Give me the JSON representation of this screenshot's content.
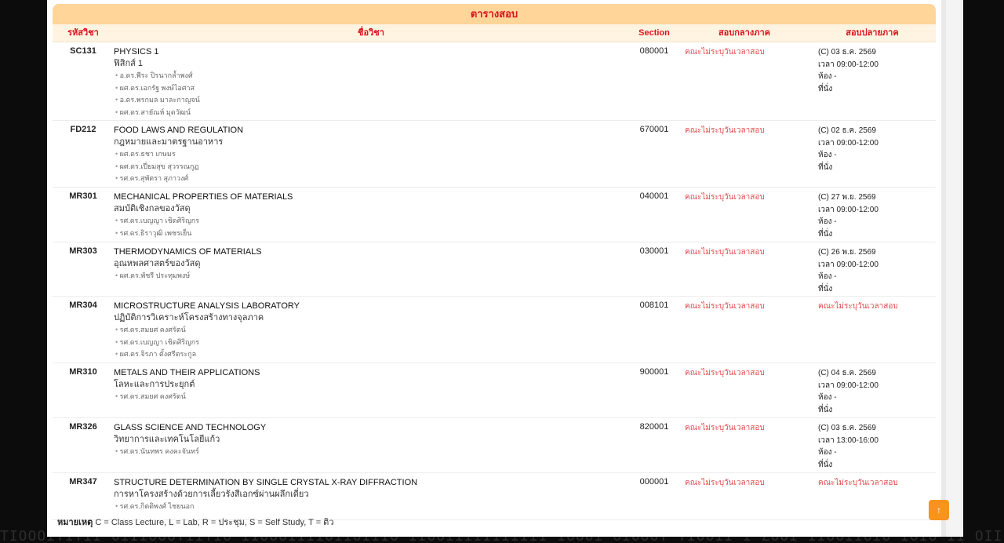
{
  "background_text": "ΤΙΟΟΟΙΤΙΥΊΙ ΟΙΙΙΟΟΟΤΙΙΤΙΟ ΊΙΟΟΟΙΙΊΙΟΙΙΟΊΙΙΟ ΙΙΟΟΙΙΙΙΙΙΙΙΙΙΙ ΙΟΟΟΙ ΟΙΟΟΟΥ ΥΙΟΟΙΙ Ι ΖΟΟΙ ΙΙΟΟΙΙΟΙΟ ΙΟΊΟ ΙΙ ΟΙΙ",
  "table": {
    "title": "ตารางสอบ",
    "headers": {
      "code": "รหัสวิชา",
      "name": "ชื่อวิชา",
      "section": "Section",
      "midterm": "สอบกลางภาค",
      "final": "สอบปลายภาค"
    },
    "rows": [
      {
        "code": "SC131",
        "name_en": "PHYSICS 1",
        "name_th": "ฟิสิกส์ 1",
        "instructors": [
          "อ.ดร.พีระ ปิรนากล้ำพงศ์",
          "ผศ.ดร.เอกรัฐ พงษ์ไอศาส",
          "อ.ดร.พรกมล มาละกาญจน์",
          "ผศ.ดร.สายัณห์ มุดวัฒน์"
        ],
        "section": "080001",
        "midterm": "คณะไม่ระบุวันเวลาสอบ",
        "final": [
          "(C) 03 ธ.ค. 2569",
          "เวลา 09:00-12:00",
          "ห้อง -",
          "ที่นั่ง"
        ]
      },
      {
        "code": "FD212",
        "name_en": "FOOD LAWS AND REGULATION",
        "name_th": "กฎหมายและมาตรฐานอาหาร",
        "instructors": [
          "ผศ.ดร.ธชา เกษมร",
          "ผศ.ดร.เปี่ยมสุข สุวรรณกูฏ",
          "รศ.ดร.สุพัตรา สุภาวงศ์"
        ],
        "section": "670001",
        "midterm": "คณะไม่ระบุวันเวลาสอบ",
        "final": [
          "(C) 02 ธ.ค. 2569",
          "เวลา 09:00-12:00",
          "ห้อง -",
          "ที่นั่ง"
        ]
      },
      {
        "code": "MR301",
        "name_en": "MECHANICAL PROPERTIES OF MATERIALS",
        "name_th": "สมบัติเชิงกลของวัสดุ",
        "instructors": [
          "รศ.ดร.เบญญา เชิดศิริญกร",
          "รศ.ดร.ธิราวุฒิ เพชรเย็น"
        ],
        "section": "040001",
        "midterm": "คณะไม่ระบุวันเวลาสอบ",
        "final": [
          "(C) 27 พ.ย. 2569",
          "เวลา 09:00-12:00",
          "ห้อง -",
          "ที่นั่ง"
        ]
      },
      {
        "code": "MR303",
        "name_en": "THERMODYNAMICS OF MATERIALS",
        "name_th": "อุณหพลศาสตร์ของวัสดุ",
        "instructors": [
          "ผศ.ดร.พัชรี ประทุมพงษ์"
        ],
        "section": "030001",
        "midterm": "คณะไม่ระบุวันเวลาสอบ",
        "final": [
          "(C) 26 พ.ย. 2569",
          "เวลา 09:00-12:00",
          "ห้อง -",
          "ที่นั่ง"
        ]
      },
      {
        "code": "MR304",
        "name_en": "MICROSTRUCTURE ANALYSIS LABORATORY",
        "name_th": "ปฏิบัติการวิเคราะห์โครงสร้างทางจุลภาค",
        "instructors": [
          "รศ.ดร.สมยศ คงศรัตน์",
          "รศ.ดร.เบญญา เชิดศิริญกร",
          "ผศ.ดร.จิรภา ตั้งศรีตระกูล"
        ],
        "section": "008101",
        "midterm": "คณะไม่ระบุวันเวลาสอบ",
        "final": [
          "คณะไม่ระบุวันเวลาสอบ"
        ],
        "final_tba": true
      },
      {
        "code": "MR310",
        "name_en": "METALS AND THEIR APPLICATIONS",
        "name_th": "โลหะและการประยุกต์",
        "instructors": [
          "รศ.ดร.สมยศ คงศรัตน์"
        ],
        "section": "900001",
        "midterm": "คณะไม่ระบุวันเวลาสอบ",
        "final": [
          "(C) 04 ธ.ค. 2569",
          "เวลา 09:00-12:00",
          "ห้อง -",
          "ที่นั่ง"
        ]
      },
      {
        "code": "MR326",
        "name_en": "GLASS SCIENCE AND TECHNOLOGY",
        "name_th": "วิทยาการและเทคโนโลยีแก้ว",
        "instructors": [
          "รศ.ดร.นันทพร คงคะจันทร์"
        ],
        "section": "820001",
        "midterm": "คณะไม่ระบุวันเวลาสอบ",
        "final": [
          "(C) 03 ธ.ค. 2569",
          "เวลา 13:00-16:00",
          "ห้อง -",
          "ที่นั่ง"
        ]
      },
      {
        "code": "MR347",
        "name_en": "STRUCTURE DETERMINATION BY SINGLE CRYSTAL X-RAY DIFFRACTION",
        "name_th": "การหาโครงสร้างด้วยการเลี้ยวรังสีเอกซ์ผ่านผลึกเดี่ยว",
        "instructors": [
          "รศ.ดร.กิตติพงศ์ ไชยนอก"
        ],
        "section": "000001",
        "midterm": "คณะไม่ระบุวันเวลาสอบ",
        "final": [
          "คณะไม่ระบุวันเวลาสอบ"
        ],
        "final_tba": true
      }
    ]
  },
  "footer": {
    "label": "หมายเหตุ",
    "text": "C = Class Lecture, L = Lab, R = ประชุม, S = Self Study, T = ติว"
  },
  "back_to_top": {
    "icon": "arrow-up-icon",
    "glyph": "↑",
    "color": "#f7941d"
  },
  "colors": {
    "header_bar": "#ffd599",
    "header_text": "#d9141c",
    "subheader_bg": "#fff4e2",
    "tba_text": "#e34a4a"
  }
}
